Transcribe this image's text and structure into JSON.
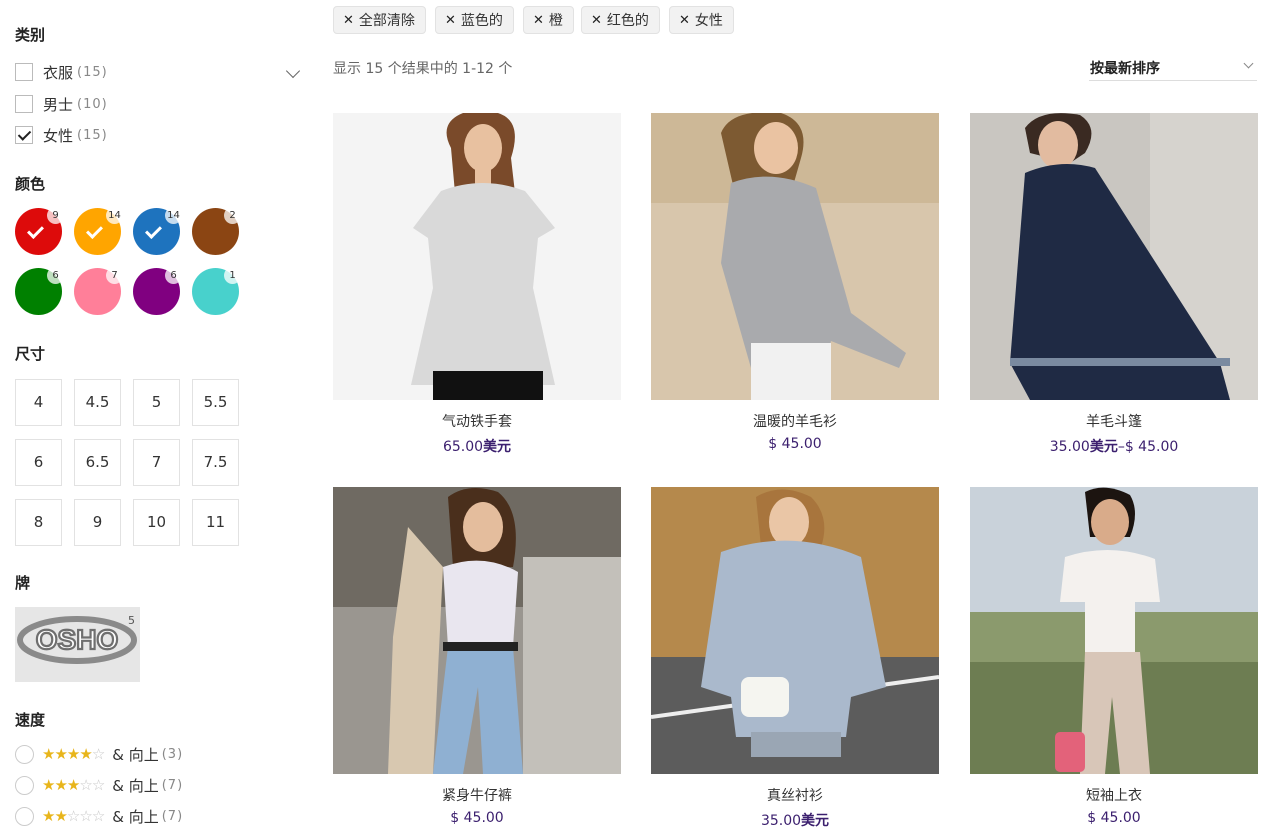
{
  "sidebar": {
    "category": {
      "title": "类别",
      "items": [
        {
          "label": "衣服",
          "count": "(15)",
          "checked": false
        },
        {
          "label": "男士",
          "count": "(10)",
          "checked": false
        },
        {
          "label": "女性",
          "count": "(15)",
          "checked": true
        }
      ]
    },
    "color": {
      "title": "颜色",
      "swatches": [
        {
          "name": "red",
          "hex": "#dd0b0b",
          "count": "9",
          "selected": true
        },
        {
          "name": "orange",
          "hex": "#ffa500",
          "count": "14",
          "selected": true
        },
        {
          "name": "blue",
          "hex": "#1e73be",
          "count": "14",
          "selected": true
        },
        {
          "name": "brown",
          "hex": "#8b4513",
          "count": "2",
          "selected": false
        },
        {
          "name": "green",
          "hex": "#008000",
          "count": "6",
          "selected": false
        },
        {
          "name": "pink",
          "hex": "#ff7f99",
          "count": "7",
          "selected": false
        },
        {
          "name": "purple",
          "hex": "#800080",
          "count": "6",
          "selected": false
        },
        {
          "name": "turquoise",
          "hex": "#48d1cc",
          "count": "1",
          "selected": false
        }
      ]
    },
    "size": {
      "title": "尺寸",
      "options": [
        "4",
        "4.5",
        "5",
        "5.5",
        "6",
        "6.5",
        "7",
        "7.5",
        "8",
        "9",
        "10",
        "11"
      ]
    },
    "brand": {
      "title": "牌",
      "logo_text": "OSHO",
      "count": "5"
    },
    "rating": {
      "title": "速度",
      "items": [
        {
          "stars": 4,
          "label": "& 向上",
          "count": "(3)"
        },
        {
          "stars": 3,
          "label": "& 向上",
          "count": "(7)"
        },
        {
          "stars": 2,
          "label": "& 向上",
          "count": "(7)"
        }
      ]
    }
  },
  "filters": {
    "chips": [
      "全部清除",
      "蓝色的",
      "橙",
      "红色的",
      "女性"
    ]
  },
  "toolbar": {
    "result_text": "显示 15 个结果中的 1-12 个",
    "sort_label": "按最新排序"
  },
  "products": [
    {
      "name": "气动铁手套",
      "price_main": "65.00",
      "price_suffix": "美元",
      "price_tail": "",
      "image": "woman-white-tunic"
    },
    {
      "name": "温暖的羊毛衫",
      "price_main": "$ 45.00",
      "price_suffix": "",
      "price_tail": "",
      "image": "woman-grey-sweater"
    },
    {
      "name": "羊毛斗篷",
      "price_main": "35.00",
      "price_suffix": "美元",
      "price_tail": "–$ 45.00",
      "image": "woman-navy-poncho"
    },
    {
      "name": "紧身牛仔裤",
      "price_main": "$ 45.00",
      "price_suffix": "",
      "price_tail": "",
      "image": "woman-jeans-street"
    },
    {
      "name": "真丝衬衫",
      "price_main": "35.00",
      "price_suffix": "美元",
      "price_tail": "",
      "image": "woman-blue-coat"
    },
    {
      "name": "短袖上衣",
      "price_main": "$ 45.00",
      "price_suffix": "",
      "price_tail": "",
      "image": "woman-white-top-field"
    }
  ],
  "colors": {
    "accent": "#3b1f6e",
    "star": "#e8b51b"
  }
}
